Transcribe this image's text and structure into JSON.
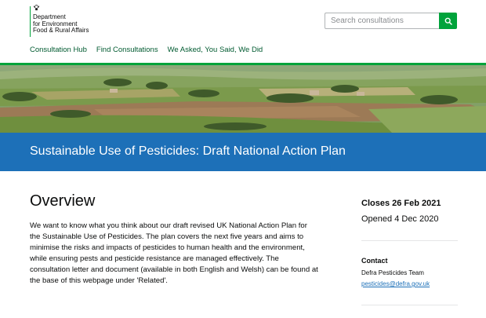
{
  "header": {
    "org_lines": [
      "Department",
      "for Environment",
      "Food & Rural Affairs"
    ],
    "crest_icon": "royal-crest-icon",
    "search": {
      "placeholder": "Search consultations",
      "icon": "search-icon"
    },
    "accent_color": "#00a33b"
  },
  "nav": {
    "items": [
      {
        "label": "Consultation Hub"
      },
      {
        "label": "Find Consultations"
      },
      {
        "label": "We Asked, You Said, We Did"
      }
    ]
  },
  "banner": {
    "title": "Sustainable Use of Pesticides: Draft National Action Plan",
    "color": "#1d70b8"
  },
  "overview": {
    "heading": "Overview",
    "body": "We want to know what you think about our draft revised UK National Action Plan for the Sustainable Use of Pesticides. The plan covers the next five years and aims to minimise the risks and impacts of pesticides to human health and the environment, while ensuring pests and pesticide resistance are managed effectively. The consultation letter and document (available in both English and Welsh) can be found at the base of this webpage under 'Related'."
  },
  "sidebar": {
    "closes": "Closes 26 Feb 2021",
    "opened": "Opened 4 Dec 2020",
    "contact_heading": "Contact",
    "contact_team": "Defra Pesticides Team",
    "contact_email": "pesticides@defra.gov.uk"
  }
}
